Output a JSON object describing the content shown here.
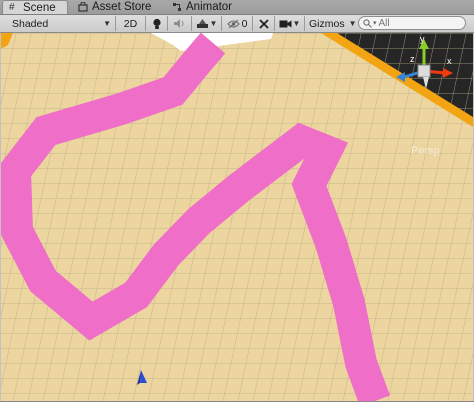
{
  "tabs": [
    {
      "label": "Scene",
      "icon": "grid-icon",
      "active": true
    },
    {
      "label": "Asset Store",
      "icon": "shopping-bag-icon",
      "active": false
    },
    {
      "label": "Animator",
      "icon": "animator-icon",
      "active": false
    }
  ],
  "toolbar": {
    "shading_mode": "Shaded",
    "mode_2d": "2D",
    "lighting_icon": "light-bulb-icon",
    "audio_icon": "speaker-icon",
    "effects_icon": "effects-icon",
    "hidden_count": "0",
    "tools_icon": "tools-icon",
    "camera_icon": "camera-icon",
    "gizmos_label": "Gizmos",
    "search_placeholder": "All"
  },
  "scene": {
    "view_label": "Persp",
    "axes": {
      "y": "y",
      "x": "x",
      "z": "z"
    },
    "colors": {
      "ground": "#ecd59f",
      "grid_line": "#b9ab88",
      "path": "#ee6ec8",
      "border_wall": "#f2a413",
      "sky": "#a3a3a3",
      "dark_floor": "#262626"
    }
  }
}
